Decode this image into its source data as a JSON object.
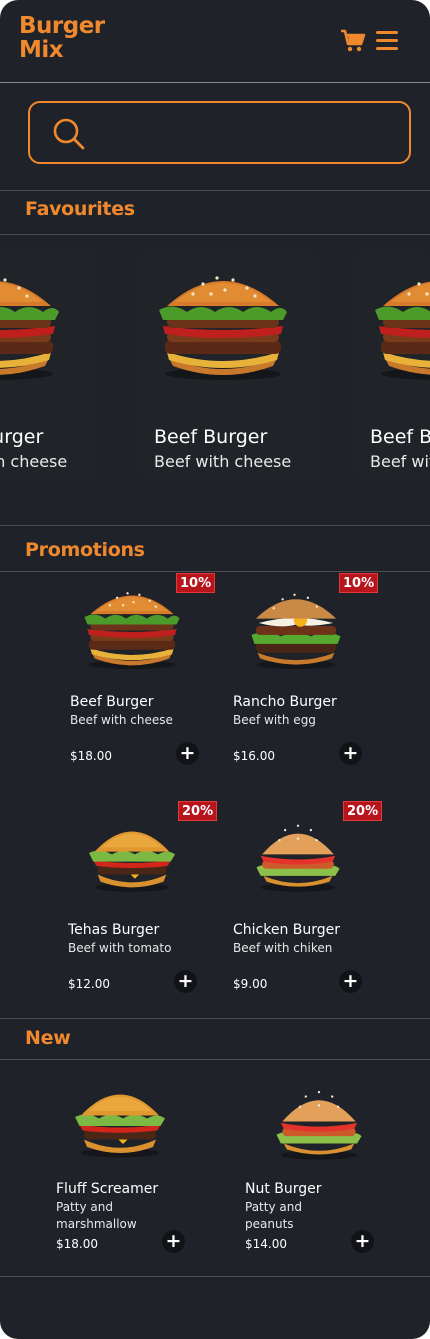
{
  "header": {
    "logo_line1": "Burger",
    "logo_line2": "Mix",
    "cart_icon": "cart-icon",
    "menu_icon": "hamburger-menu-icon"
  },
  "search": {
    "placeholder": "",
    "icon": "search-icon"
  },
  "colors": {
    "accent": "#f0892e",
    "background": "#1f2228",
    "badge": "#b8141c"
  },
  "sections": {
    "favourites": "Favourites",
    "promotions": "Promotions",
    "new": "New"
  },
  "favourites": [
    {
      "name": "Beef Burger",
      "desc": "Beef with cheese"
    },
    {
      "name": "Beef Burger",
      "desc": "Beef with cheese"
    },
    {
      "name": "Beef Burger",
      "desc": "Beef with cheese"
    }
  ],
  "promotions": [
    {
      "name": "Beef Burger",
      "desc": "Beef with cheese",
      "price": "$18.00",
      "badge": "10%"
    },
    {
      "name": "Rancho Burger",
      "desc": "Beef with egg",
      "price": "$16.00",
      "badge": "10%"
    },
    {
      "name": "Tehas Burger",
      "desc": "Beef with tomato",
      "price": "$12.00",
      "badge": "20%"
    },
    {
      "name": "Chicken Burger",
      "desc": "Beef with chiken",
      "price": "$9.00",
      "badge": "20%"
    }
  ],
  "new_items": [
    {
      "name": "Fluff Screamer",
      "desc": "Patty and marshmallow",
      "price": "$18.00"
    },
    {
      "name": "Nut Burger",
      "desc": "Patty and peanuts",
      "price": "$14.00"
    }
  ],
  "add_label": "+"
}
